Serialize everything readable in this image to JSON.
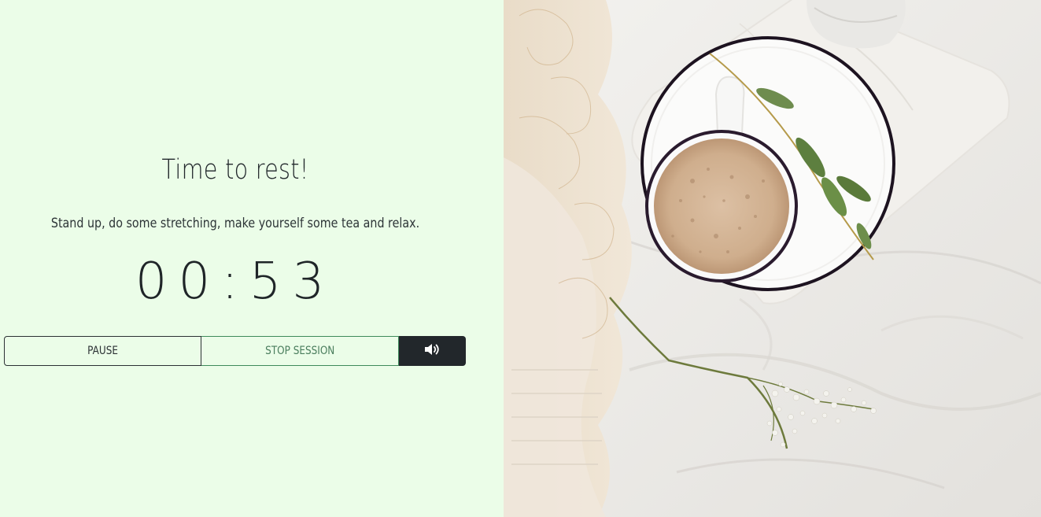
{
  "rest": {
    "title": "Time to rest!",
    "subtitle": "Stand up, do some stretching, make yourself some tea and relax.",
    "timer": "00:53"
  },
  "controls": {
    "pause_label": "PAUSE",
    "stop_label": "STOP SESSION",
    "sound_icon": "volume-up-icon"
  },
  "colors": {
    "panel_background": "#ebfde8",
    "dark": "#22272b",
    "green_accent": "#3e8a5a"
  },
  "photo": {
    "subject": "coffee-cup-on-bed-icon"
  }
}
